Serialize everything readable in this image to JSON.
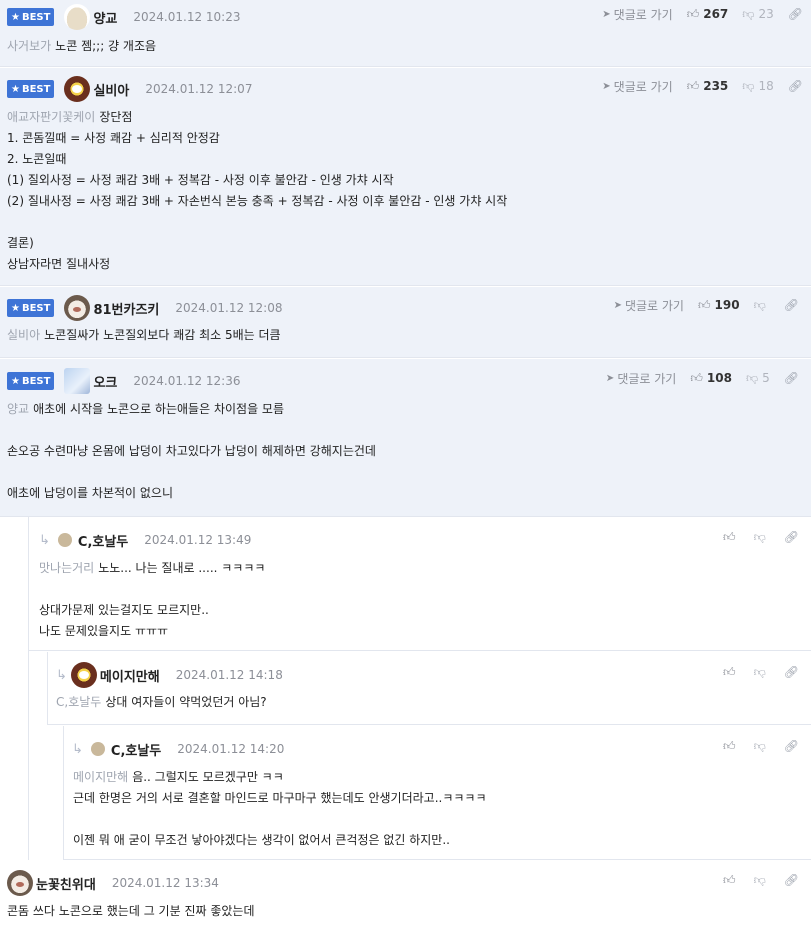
{
  "common": {
    "best_label": "BEST",
    "goto_label": "댓글로 가기"
  },
  "comments": [
    {
      "nick": "양교",
      "date": "2024.01.12 10:23",
      "up": "267",
      "down": "23",
      "mention": "사거보가",
      "lines": [
        "노콘 젬;;; 걍 개조음"
      ]
    },
    {
      "nick": "실비아",
      "date": "2024.01.12 12:07",
      "up": "235",
      "down": "18",
      "mention": "애교자판기꽃케이",
      "first": "장단점",
      "lines": [
        "1. 콘돔낄때 = 사정 쾌감 + 심리적 안정감",
        "2. 노콘일때",
        "(1) 질외사정 = 사정 쾌감 3배 + 정복감 - 사정 이후 불안감 - 인생 가챠 시작",
        "(2) 질내사정 = 사정 쾌감 3배 + 자손번식 본능 충족 + 정복감 - 사정 이후 불안감 - 인생 가챠 시작",
        "",
        "결론)",
        "상남자라면 질내사정"
      ]
    },
    {
      "nick": "81번카즈키",
      "date": "2024.01.12 12:08",
      "up": "190",
      "down": "",
      "mention": "실비아",
      "lines": [
        "노콘질싸가 노콘질외보다 쾌감 최소 5배는 더큼"
      ]
    },
    {
      "nick": "오크",
      "date": "2024.01.12 12:36",
      "up": "108",
      "down": "5",
      "mention": "양교",
      "first": "애초에 시작을 노콘으로 하는애들은 차이점을 모름",
      "lines": [
        "",
        "손오공 수련마냥 온몸에 납덩이 차고있다가 납덩이 해제하면 강해지는건데",
        "",
        "애초에 납덩이를 차본적이 없으니"
      ]
    }
  ],
  "replies": [
    {
      "nick": "C,호날두",
      "date": "2024.01.12 13:49",
      "mention": "맛나는거리",
      "first": "노노... 나는 질내로 ..... ㅋㅋㅋㅋ",
      "lines": [
        "",
        "상대가문제 있는걸지도 모르지만..",
        "나도 문제있을지도 ㅠㅠㅠ"
      ]
    },
    {
      "nick": "메이지만해",
      "date": "2024.01.12 14:18",
      "mention": "C,호날두",
      "first": "상대 여자들이 약먹었던거 아님?",
      "lines": []
    },
    {
      "nick": "C,호날두",
      "date": "2024.01.12 14:20",
      "mention": "메이지만해",
      "first": "음.. 그럴지도 모르겠구만 ㅋㅋ",
      "lines": [
        "근데 한명은 거의 서로 결혼할 마인드로 마구마구 했는데도 안생기더라고..ㅋㅋㅋㅋ",
        "",
        "이젠 뭐 애 굳이 무조건 낳아야겠다는 생각이 없어서 큰걱정은 없긴 하지만.."
      ]
    },
    {
      "nick": "눈꽃친위대",
      "date": "2024.01.12 13:34",
      "mention": "",
      "first": "콘돔 쓰다 노콘으로 했는데 그 기분 진짜 좋았는데",
      "lines": []
    }
  ],
  "icons": {
    "goto": "send-arrow-icon",
    "up": "thumbs-up-icon",
    "down": "thumbs-down-icon",
    "link": "link-icon",
    "reply": "reply-arrow-icon",
    "star": "star-icon"
  }
}
